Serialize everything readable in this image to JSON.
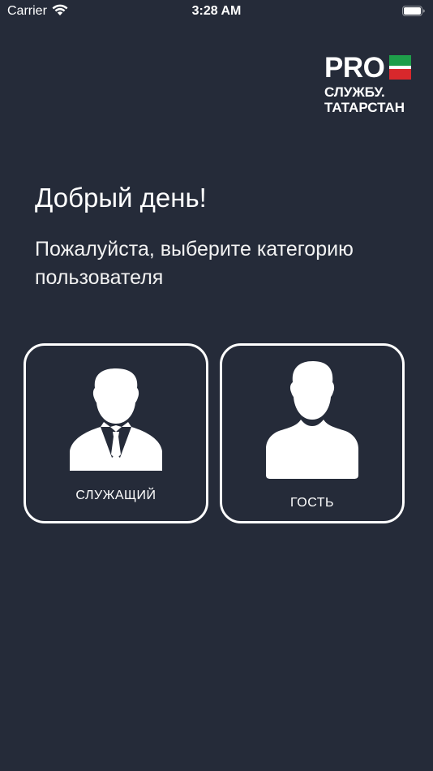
{
  "status_bar": {
    "carrier": "Carrier",
    "time": "3:28 AM"
  },
  "logo": {
    "pro": "PRO",
    "line1": "СЛУЖБУ.",
    "line2": "ТАТАРСТАН"
  },
  "greeting": "Добрый день!",
  "subtitle": "Пожалуйста, выберите категорию пользователя",
  "categories": [
    {
      "label": "СЛУЖАЩИЙ",
      "icon": "employee-avatar-icon"
    },
    {
      "label": "ГОСТЬ",
      "icon": "guest-avatar-icon"
    }
  ],
  "colors": {
    "background": "#252b39",
    "flag_green": "#1e9e4a",
    "flag_red": "#d8282c",
    "text": "#ffffff"
  }
}
